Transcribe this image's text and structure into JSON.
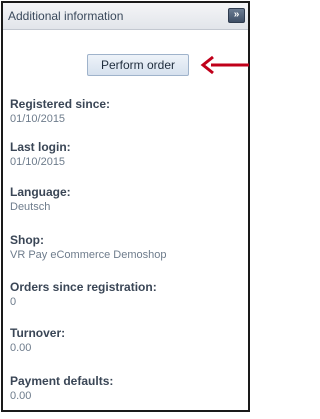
{
  "panel": {
    "title": "Additional information",
    "collapse_glyph": "»",
    "order_button_label": "Perform order"
  },
  "fields": [
    {
      "label": "Registered since:",
      "value": "01/10/2015"
    },
    {
      "label": "Last login:",
      "value": "01/10/2015"
    },
    {
      "label": "Language:",
      "value": "Deutsch"
    },
    {
      "label": "Shop:",
      "value": "VR Pay eCommerce Demoshop"
    },
    {
      "label": "Orders since registration:",
      "value": "0"
    },
    {
      "label": "Turnover:",
      "value": "0.00"
    },
    {
      "label": "Payment defaults:",
      "value": "0.00"
    }
  ],
  "annotation": {
    "icon": "arrow-left-icon",
    "color": "#c0001a"
  }
}
